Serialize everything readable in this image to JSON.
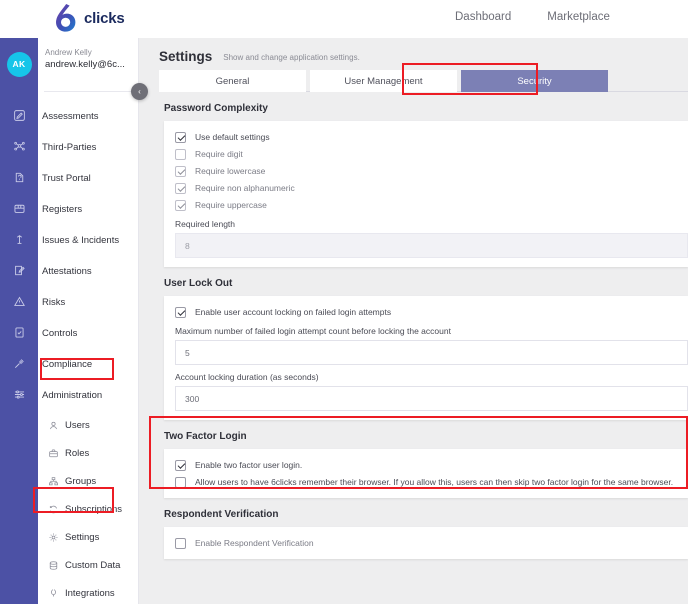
{
  "brand": {
    "logo_text": "clicks",
    "logo_icon": "sixclicks-logo-icon",
    "accent_purple": "#4c51a5",
    "accent_cyan": "#16c5e9",
    "annotation_red": "#ec1c24",
    "tab_active_bg": "#7c80b5"
  },
  "topnav": {
    "items": [
      {
        "label": "Dashboard"
      },
      {
        "label": "Marketplace"
      }
    ]
  },
  "user": {
    "initials": "AK",
    "name": "Andrew Kelly",
    "email": "andrew.kelly@6c..."
  },
  "collapse": {
    "icon": "chevron-left-icon",
    "glyph": "‹"
  },
  "sidebar": {
    "items": [
      {
        "label": "Assessments",
        "icon": "assessment-pencil-icon"
      },
      {
        "label": "Third-Parties",
        "icon": "network-nodes-icon"
      },
      {
        "label": "Trust Portal",
        "icon": "shield-document-icon"
      },
      {
        "label": "Registers",
        "icon": "archive-box-icon"
      },
      {
        "label": "Issues & Incidents",
        "icon": "alert-tower-icon"
      },
      {
        "label": "Attestations",
        "icon": "document-signature-icon"
      },
      {
        "label": "Risks",
        "icon": "warning-triangle-icon"
      },
      {
        "label": "Controls",
        "icon": "checklist-document-icon"
      },
      {
        "label": "Compliance",
        "icon": "gavel-icon"
      },
      {
        "label": "Administration",
        "icon": "sliders-icon"
      }
    ],
    "admin_children": [
      {
        "label": "Users",
        "icon": "user-icon"
      },
      {
        "label": "Roles",
        "icon": "briefcase-icon"
      },
      {
        "label": "Groups",
        "icon": "org-chart-icon"
      },
      {
        "label": "Subscriptions",
        "icon": "refresh-card-icon"
      },
      {
        "label": "Settings",
        "icon": "gear-icon"
      },
      {
        "label": "Custom Data",
        "icon": "database-icon"
      },
      {
        "label": "Integrations",
        "icon": "plug-icon"
      }
    ]
  },
  "page": {
    "title": "Settings",
    "subtitle": "Show and change application settings.",
    "tabs": [
      {
        "label": "General",
        "active": false
      },
      {
        "label": "User Management",
        "active": false
      },
      {
        "label": "Security",
        "active": true
      }
    ]
  },
  "password_complexity": {
    "heading": "Password Complexity",
    "options": [
      {
        "label": "Use default settings",
        "checked": true,
        "disabled": false
      },
      {
        "label": "Require digit",
        "checked": false,
        "disabled": true
      },
      {
        "label": "Require lowercase",
        "checked": true,
        "disabled": true
      },
      {
        "label": "Require non alphanumeric",
        "checked": true,
        "disabled": true
      },
      {
        "label": "Require uppercase",
        "checked": true,
        "disabled": true
      }
    ],
    "required_length_label": "Required length",
    "required_length_value": "8"
  },
  "user_lock_out": {
    "heading": "User Lock Out",
    "enable_label": "Enable user account locking on failed login attempts",
    "enable_checked": true,
    "max_attempts_label": "Maximum number of failed login attempt count before locking the account",
    "max_attempts_value": "5",
    "duration_label": "Account locking duration (as seconds)",
    "duration_value": "300"
  },
  "two_factor_login": {
    "heading": "Two Factor Login",
    "options": [
      {
        "label": "Enable two factor user login.",
        "checked": true
      },
      {
        "label": "Allow users to have 6clicks remember their browser. If you allow this, users can then skip two factor login for the same browser.",
        "checked": false
      }
    ]
  },
  "respondent_verification": {
    "heading": "Respondent Verification",
    "options": [
      {
        "label": "Enable Respondent Verification",
        "checked": false
      }
    ]
  },
  "annotations": [
    {
      "name": "administration-highlight"
    },
    {
      "name": "settings-highlight"
    },
    {
      "name": "security-tab-highlight"
    },
    {
      "name": "two-factor-login-highlight"
    }
  ]
}
